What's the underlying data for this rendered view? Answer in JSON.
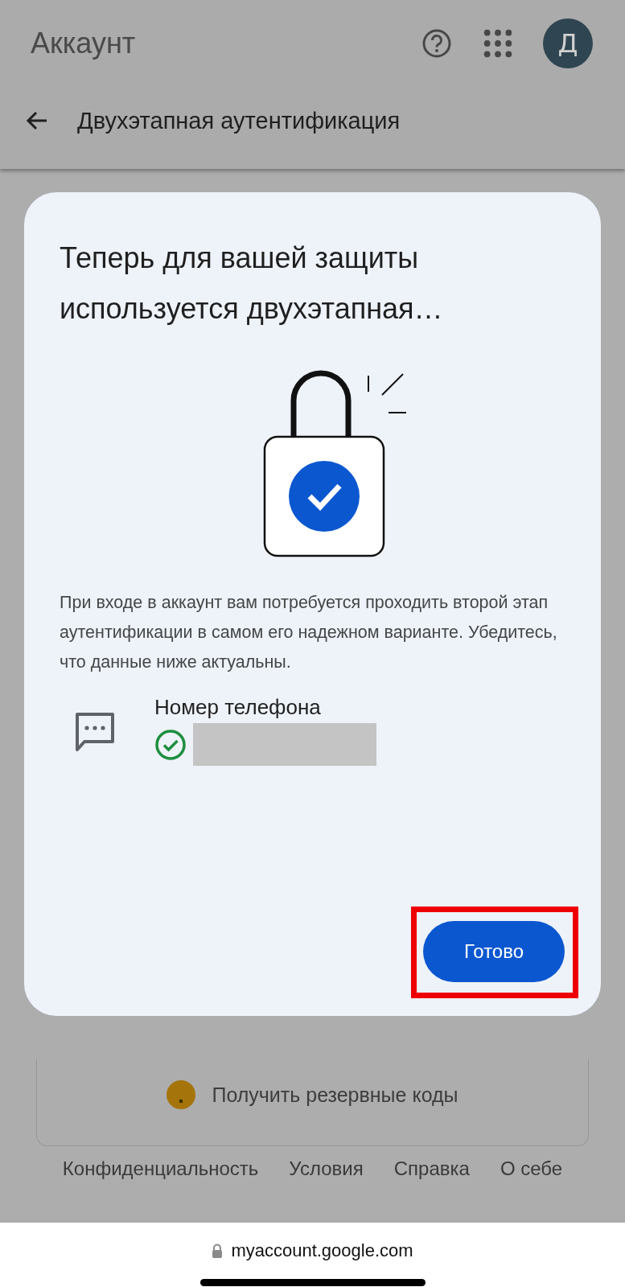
{
  "header": {
    "title": "Аккаунт",
    "avatar_letter": "Д"
  },
  "subheader": {
    "title": "Двухэтапная аутентификация"
  },
  "dialog": {
    "title": "Теперь для вашей защиты используется двухэтапная…",
    "body": "При входе в аккаунт вам потребуется проходить второй этап аутентификации в самом его надежном варианте. Убедитесь, что данные ниже актуальны.",
    "method": {
      "label": "Номер телефона",
      "verified": true
    },
    "button": {
      "label": "Готово",
      "highlighted": true
    }
  },
  "backup_card": {
    "label": "Получить резервные коды"
  },
  "footer": {
    "links": [
      "Конфиденциальность",
      "Условия",
      "Справка",
      "О себе"
    ]
  },
  "browser": {
    "url": "myaccount.google.com"
  }
}
